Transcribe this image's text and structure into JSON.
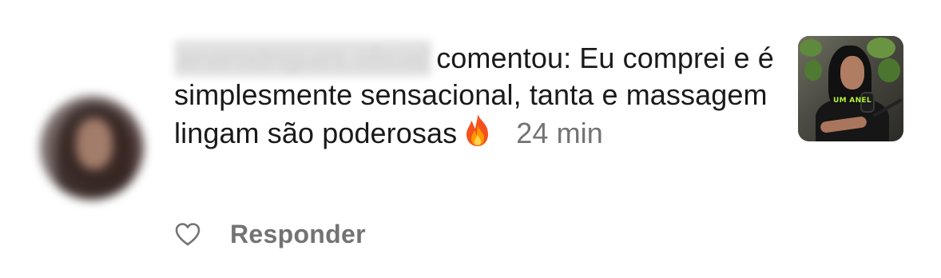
{
  "comment": {
    "username": "anarodrigues.oficial",
    "text": "comentou: Eu comprei e é simplesmente sensacional, tanta e massagem lingam são poderosas",
    "emoji": "🔥",
    "timestamp": "24 min"
  },
  "actions": {
    "like_icon": "heart-outline-icon",
    "reply_label": "Responder"
  },
  "thumbnail": {
    "caption": "UM ANEL"
  },
  "colors": {
    "text": "#1a1a1a",
    "muted": "#737373",
    "background": "#ffffff"
  }
}
